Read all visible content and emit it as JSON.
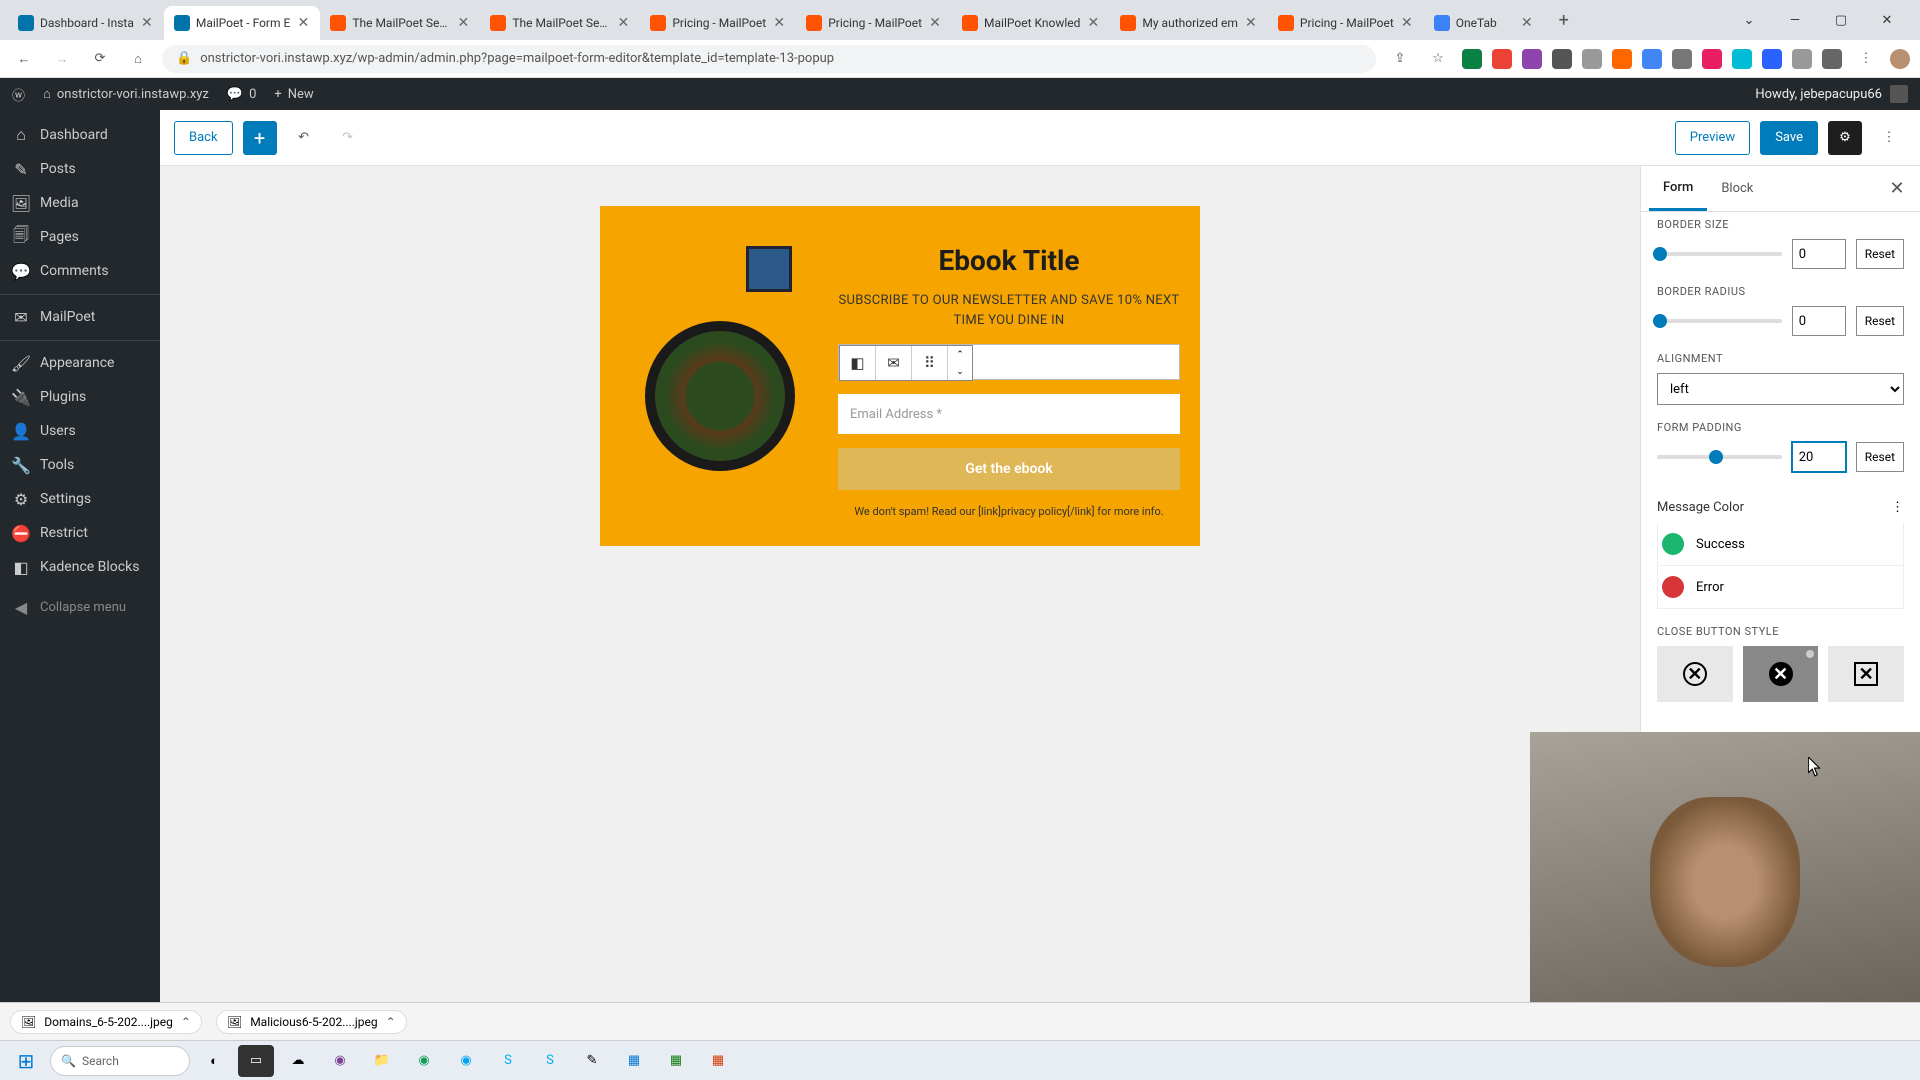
{
  "browser": {
    "tabs": [
      {
        "title": "Dashboard - Insta",
        "fav": "wp"
      },
      {
        "title": "MailPoet - Form E",
        "fav": "wp",
        "active": true
      },
      {
        "title": "The MailPoet Send",
        "fav": "mp"
      },
      {
        "title": "The MailPoet Send",
        "fav": "mp"
      },
      {
        "title": "Pricing - MailPoet",
        "fav": "mp"
      },
      {
        "title": "Pricing - MailPoet",
        "fav": "mp"
      },
      {
        "title": "MailPoet Knowled",
        "fav": "mp"
      },
      {
        "title": "My authorized em",
        "fav": "mp"
      },
      {
        "title": "Pricing - MailPoet",
        "fav": "mp"
      },
      {
        "title": "OneTab",
        "fav": "ot"
      }
    ],
    "url": "onstrictor-vori.instawp.xyz/wp-admin/admin.php?page=mailpoet-form-editor&template_id=template-13-popup"
  },
  "wpbar": {
    "site": "onstrictor-vori.instawp.xyz",
    "comments": "0",
    "new": "New",
    "howdy": "Howdy, jebepacupu66"
  },
  "sidebar": {
    "items": [
      {
        "label": "Dashboard",
        "icon": "⌂"
      },
      {
        "label": "Posts",
        "icon": "✎"
      },
      {
        "label": "Media",
        "icon": "🖼"
      },
      {
        "label": "Pages",
        "icon": "🗐"
      },
      {
        "label": "Comments",
        "icon": "💬"
      },
      {
        "label": "MailPoet",
        "icon": "✉"
      },
      {
        "label": "Appearance",
        "icon": "🖌"
      },
      {
        "label": "Plugins",
        "icon": "🔌"
      },
      {
        "label": "Users",
        "icon": "👤"
      },
      {
        "label": "Tools",
        "icon": "🔧"
      },
      {
        "label": "Settings",
        "icon": "⚙"
      },
      {
        "label": "Restrict",
        "icon": "⛔"
      },
      {
        "label": "Kadence Blocks",
        "icon": "◧"
      }
    ],
    "collapse": "Collapse menu"
  },
  "topbar": {
    "back": "Back",
    "preview": "Preview",
    "save": "Save"
  },
  "popup": {
    "title": "Ebook Title",
    "sub": "SUBSCRIBE TO OUR NEWSLETTER AND SAVE 10% NEXT TIME YOU DINE IN",
    "email_ph": "Email Address *",
    "button": "Get the ebook",
    "foot": "We don't spam! Read our [link]privacy policy[/link] for more info."
  },
  "settings": {
    "tabs": {
      "form": "Form",
      "block": "Block"
    },
    "border_size": {
      "label": "BORDER SIZE",
      "value": "0",
      "reset": "Reset"
    },
    "border_radius": {
      "label": "BORDER RADIUS",
      "value": "0",
      "reset": "Reset"
    },
    "alignment": {
      "label": "ALIGNMENT",
      "value": "left"
    },
    "padding": {
      "label": "FORM PADDING",
      "value": "20",
      "reset": "Reset"
    },
    "msg_color": {
      "title": "Message Color",
      "success": "Success",
      "error": "Error"
    },
    "close_style": {
      "label": "CLOSE BUTTON STYLE"
    }
  },
  "downloads": [
    {
      "name": "Domains_6-5-202....jpeg"
    },
    {
      "name": "Malicious6-5-202....jpeg"
    }
  ],
  "taskbar": {
    "search": "Search"
  }
}
